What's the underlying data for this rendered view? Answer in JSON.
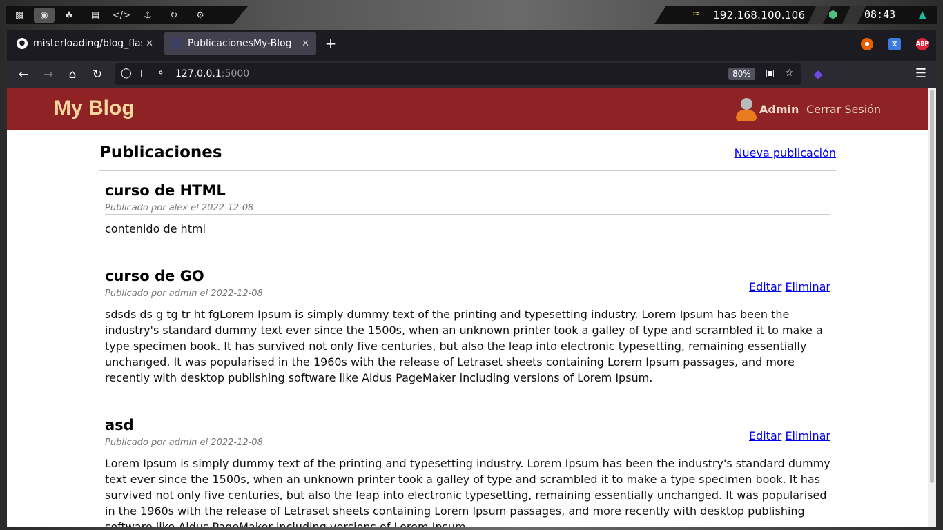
{
  "system": {
    "ip": "192.168.100.106",
    "clock": "08:43"
  },
  "tabs": [
    {
      "label": "misterloading/blog_flask",
      "active": false
    },
    {
      "label": "PublicacionesMy-Blog",
      "active": true
    }
  ],
  "urlbar": {
    "host": "127.0.0.1",
    "port": ":5000",
    "zoom": "80%"
  },
  "site": {
    "brand": "My Blog",
    "user": "Admin",
    "logout": "Cerrar Sesión",
    "header_color": "#8f2224"
  },
  "page": {
    "title": "Publicaciones",
    "new_post": "Nueva publicación"
  },
  "posts": [
    {
      "title": "curso de HTML",
      "meta": "Publicado por alex el 2022-12-08",
      "body": "contenido de html",
      "edit": "",
      "delete": ""
    },
    {
      "title": "curso de GO",
      "meta": "Publicado por admin el 2022-12-08",
      "body": "sdsds ds g tg tr ht fgLorem Ipsum is simply dummy text of the printing and typesetting industry. Lorem Ipsum has been the industry's standard dummy text ever since the 1500s, when an unknown printer took a galley of type and scrambled it to make a type specimen book. It has survived not only five centuries, but also the leap into electronic typesetting, remaining essentially unchanged. It was popularised in the 1960s with the release of Letraset sheets containing Lorem Ipsum passages, and more recently with desktop publishing software like Aldus PageMaker including versions of Lorem Ipsum.",
      "edit": "Editar",
      "delete": "Eliminar"
    },
    {
      "title": "asd",
      "meta": "Publicado por admin el 2022-12-08",
      "body": "Lorem Ipsum is simply dummy text of the printing and typesetting industry. Lorem Ipsum has been the industry's standard dummy text ever since the 1500s, when an unknown printer took a galley of type and scrambled it to make a type specimen book. It has survived not only five centuries, but also the leap into electronic typesetting, remaining essentially unchanged. It was popularised in the 1960s with the release of Letraset sheets containing Lorem Ipsum passages, and more recently with desktop publishing software like Aldus PageMaker including versions of Lorem Ipsum.",
      "edit": "Editar",
      "delete": "Eliminar"
    }
  ]
}
